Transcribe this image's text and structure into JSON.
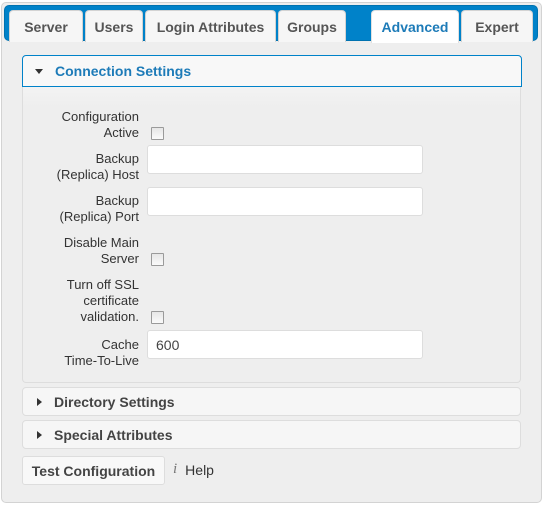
{
  "tabs": [
    {
      "label": "Server",
      "active": false
    },
    {
      "label": "Users",
      "active": false
    },
    {
      "label": "Login Attributes",
      "active": false
    },
    {
      "label": "Groups",
      "active": false
    },
    {
      "label": "Advanced",
      "active": true
    },
    {
      "label": "Expert",
      "active": false
    }
  ],
  "colors": {
    "accent": "#0082c9",
    "active_tab_text": "#1d7bb8"
  },
  "sections": {
    "connection": {
      "title": "Connection Settings",
      "expanded": true,
      "fields": {
        "configuration_active": {
          "label_l1": "Configuration",
          "label_l2": "Active",
          "checked": false
        },
        "backup_host": {
          "label_l1": "Backup",
          "label_l2": "(Replica) Host",
          "value": ""
        },
        "backup_port": {
          "label_l1": "Backup",
          "label_l2": "(Replica) Port",
          "value": ""
        },
        "disable_main_server": {
          "label_l1": "Disable Main",
          "label_l2": "Server",
          "checked": false
        },
        "turn_off_ssl": {
          "label_l1": "Turn off SSL",
          "label_l2": "certificate",
          "label_l3": "validation.",
          "checked": false
        },
        "cache_ttl": {
          "label_l1": "Cache",
          "label_l2": "Time-To-Live",
          "value": "600"
        }
      }
    },
    "directory": {
      "title": "Directory Settings",
      "expanded": false
    },
    "special": {
      "title": "Special Attributes",
      "expanded": false
    }
  },
  "footer": {
    "test_button": "Test Configuration",
    "help_icon": "info-icon",
    "help_glyph": "i",
    "help_label": "Help"
  }
}
